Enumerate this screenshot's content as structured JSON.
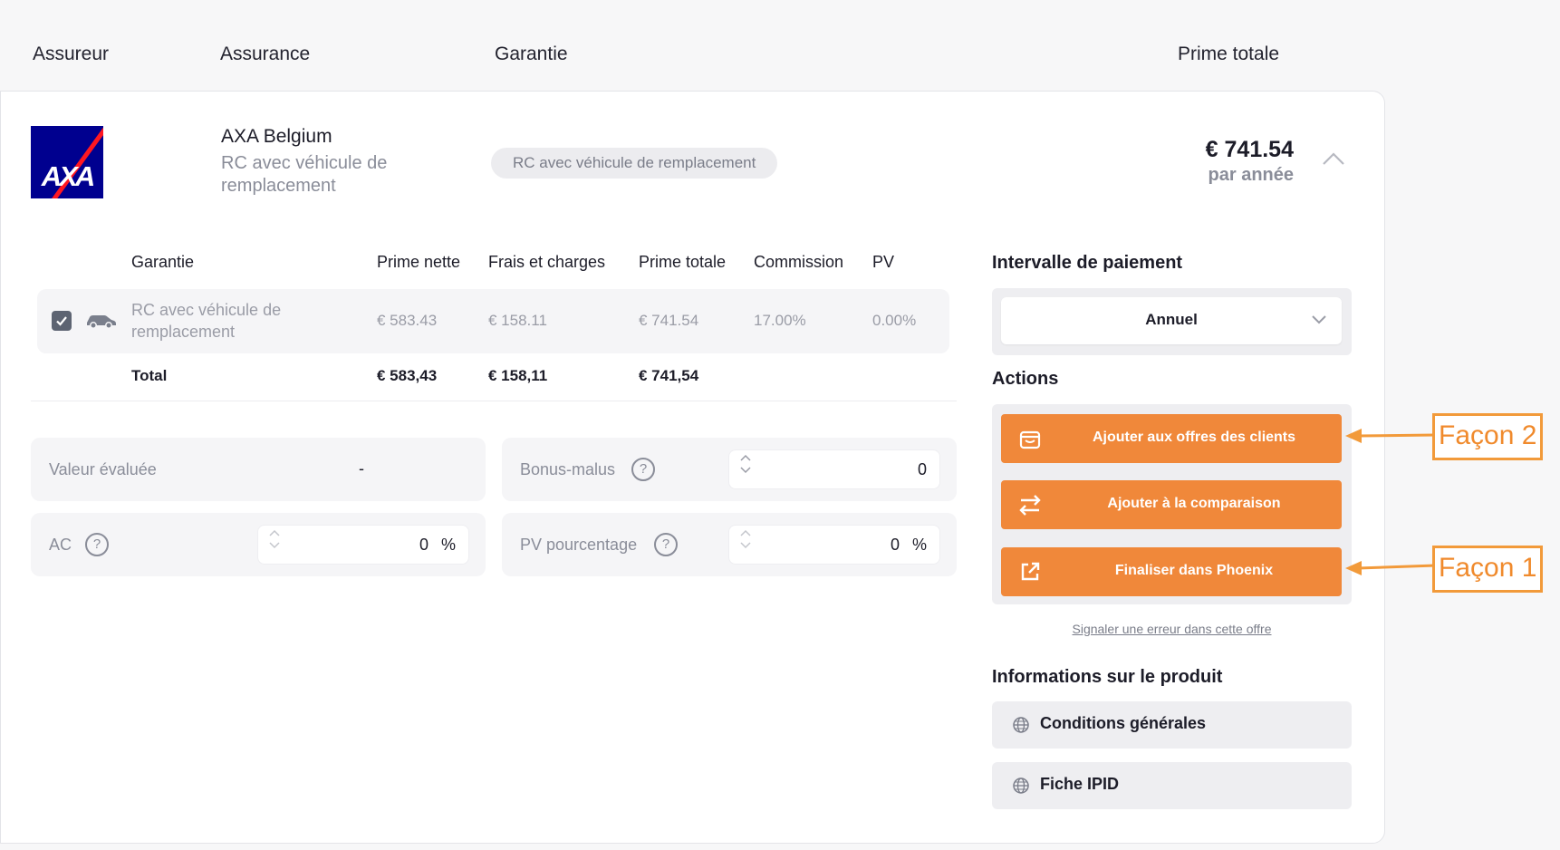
{
  "header": {
    "assureur": "Assureur",
    "assurance": "Assurance",
    "garantie": "Garantie",
    "prime_totale": "Prime totale"
  },
  "offer": {
    "logo_text": "AXA",
    "insurer": "AXA Belgium",
    "insurance": "RC avec véhicule de remplacement",
    "guarantee_pill": "RC avec véhicule de remplacement",
    "price": "€ 741.54",
    "period": "par année"
  },
  "table": {
    "headers": [
      "Garantie",
      "Prime nette",
      "Frais et charges",
      "Prime totale",
      "Commission",
      "PV"
    ],
    "row": {
      "checked": true,
      "name": "RC avec véhicule de remplacement",
      "prime_nette": "€ 583.43",
      "frais": "€ 158.11",
      "prime_totale": "€ 741.54",
      "commission": "17.00%",
      "pv": "0.00%"
    },
    "total": {
      "label": "Total",
      "prime_nette": "€ 583,43",
      "frais": "€ 158,11",
      "prime_totale": "€ 741,54"
    }
  },
  "params": {
    "valeur_label": "Valeur évaluée",
    "valeur_value": "-",
    "bonus_label": "Bonus-malus",
    "bonus_value": "0",
    "ac_label": "AC",
    "ac_value": "0",
    "ac_unit": "%",
    "pv_label": "PV pourcentage",
    "pv_value": "0",
    "pv_unit": "%",
    "help": "?"
  },
  "payment": {
    "title": "Intervalle de paiement",
    "selected": "Annuel"
  },
  "actions": {
    "title": "Actions",
    "add_offers": "Ajouter aux offres des clients",
    "add_compare": "Ajouter à la comparaison",
    "finalize": "Finaliser dans Phoenix",
    "report": "Signaler une erreur dans cette offre"
  },
  "product_info": {
    "title": "Informations sur le produit",
    "conditions": "Conditions générales",
    "ipid": "Fiche IPID"
  },
  "annotations": {
    "way2": "Façon 2",
    "way1": "Façon 1"
  },
  "colors": {
    "accent": "#f0883a",
    "axa_blue": "#00008f",
    "axa_red": "#ff1721",
    "annotation": "#f29a3a"
  }
}
